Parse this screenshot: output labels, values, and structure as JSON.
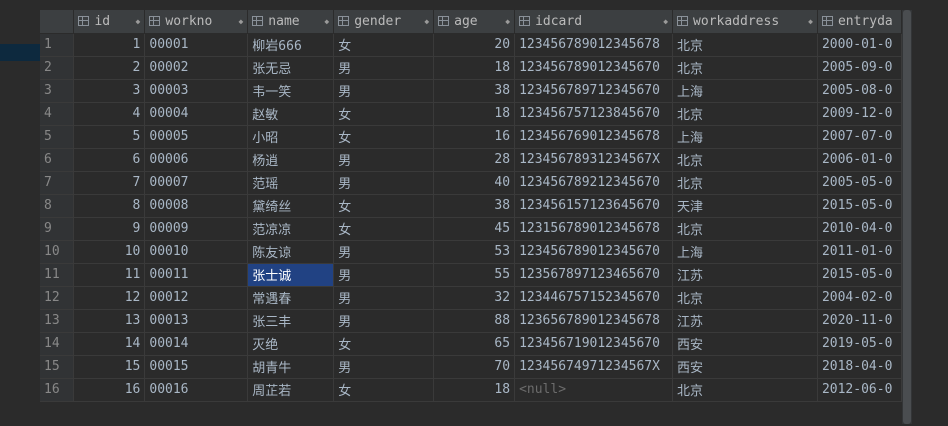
{
  "columns": [
    {
      "label": "id",
      "key": "id",
      "align": "right"
    },
    {
      "label": "workno",
      "key": "workno"
    },
    {
      "label": "name",
      "key": "name"
    },
    {
      "label": "gender",
      "key": "gender"
    },
    {
      "label": "age",
      "key": "age",
      "align": "right"
    },
    {
      "label": "idcard",
      "key": "idcard"
    },
    {
      "label": "workaddress",
      "key": "workaddress"
    },
    {
      "label": "entryda",
      "key": "entrydate"
    }
  ],
  "rows": [
    {
      "n": "1",
      "id": "1",
      "workno": "00001",
      "name": "柳岩666",
      "gender": "女",
      "age": "20",
      "idcard": "123456789012345678",
      "workaddress": "北京",
      "entrydate": "2000-01-0"
    },
    {
      "n": "2",
      "id": "2",
      "workno": "00002",
      "name": "张无忌",
      "gender": "男",
      "age": "18",
      "idcard": "123456789012345670",
      "workaddress": "北京",
      "entrydate": "2005-09-0"
    },
    {
      "n": "3",
      "id": "3",
      "workno": "00003",
      "name": "韦一笑",
      "gender": "男",
      "age": "38",
      "idcard": "123456789712345670",
      "workaddress": "上海",
      "entrydate": "2005-08-0"
    },
    {
      "n": "4",
      "id": "4",
      "workno": "00004",
      "name": "赵敏",
      "gender": "女",
      "age": "18",
      "idcard": "123456757123845670",
      "workaddress": "北京",
      "entrydate": "2009-12-0"
    },
    {
      "n": "5",
      "id": "5",
      "workno": "00005",
      "name": "小昭",
      "gender": "女",
      "age": "16",
      "idcard": "123456769012345678",
      "workaddress": "上海",
      "entrydate": "2007-07-0"
    },
    {
      "n": "6",
      "id": "6",
      "workno": "00006",
      "name": "杨逍",
      "gender": "男",
      "age": "28",
      "idcard": "12345678931234567X",
      "workaddress": "北京",
      "entrydate": "2006-01-0"
    },
    {
      "n": "7",
      "id": "7",
      "workno": "00007",
      "name": "范瑶",
      "gender": "男",
      "age": "40",
      "idcard": "123456789212345670",
      "workaddress": "北京",
      "entrydate": "2005-05-0"
    },
    {
      "n": "8",
      "id": "8",
      "workno": "00008",
      "name": "黛绮丝",
      "gender": "女",
      "age": "38",
      "idcard": "123456157123645670",
      "workaddress": "天津",
      "entrydate": "2015-05-0"
    },
    {
      "n": "9",
      "id": "9",
      "workno": "00009",
      "name": "范凉凉",
      "gender": "女",
      "age": "45",
      "idcard": "123156789012345678",
      "workaddress": "北京",
      "entrydate": "2010-04-0"
    },
    {
      "n": "10",
      "id": "10",
      "workno": "00010",
      "name": "陈友谅",
      "gender": "男",
      "age": "53",
      "idcard": "123456789012345670",
      "workaddress": "上海",
      "entrydate": "2011-01-0"
    },
    {
      "n": "11",
      "id": "11",
      "workno": "00011",
      "name": "张士诚",
      "gender": "男",
      "age": "55",
      "idcard": "123567897123465670",
      "workaddress": "江苏",
      "entrydate": "2015-05-0",
      "selected": true
    },
    {
      "n": "12",
      "id": "12",
      "workno": "00012",
      "name": "常遇春",
      "gender": "男",
      "age": "32",
      "idcard": "123446757152345670",
      "workaddress": "北京",
      "entrydate": "2004-02-0"
    },
    {
      "n": "13",
      "id": "13",
      "workno": "00013",
      "name": "张三丰",
      "gender": "男",
      "age": "88",
      "idcard": "123656789012345678",
      "workaddress": "江苏",
      "entrydate": "2020-11-0"
    },
    {
      "n": "14",
      "id": "14",
      "workno": "00014",
      "name": "灭绝",
      "gender": "女",
      "age": "65",
      "idcard": "123456719012345670",
      "workaddress": "西安",
      "entrydate": "2019-05-0"
    },
    {
      "n": "15",
      "id": "15",
      "workno": "00015",
      "name": "胡青牛",
      "gender": "男",
      "age": "70",
      "idcard": "12345674971234567X",
      "workaddress": "西安",
      "entrydate": "2018-04-0"
    },
    {
      "n": "16",
      "id": "16",
      "workno": "00016",
      "name": "周芷若",
      "gender": "女",
      "age": "18",
      "idcard": "<null>",
      "workaddress": "北京",
      "entrydate": "2012-06-0",
      "idcard_null": true
    }
  ],
  "icons": {
    "column": "column-grid-icon",
    "sort": "sort-arrows-icon"
  },
  "colors": {
    "background": "#2b2b2b",
    "header": "#3c3f41",
    "selection": "#214283",
    "null_text": "#6c6c6c"
  }
}
